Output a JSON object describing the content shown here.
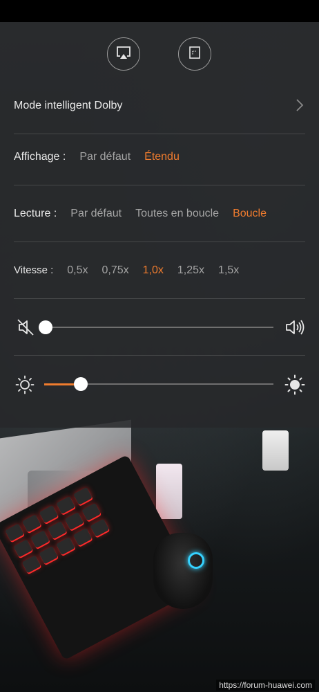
{
  "settings": {
    "dolby_label": "Mode intelligent Dolby",
    "display": {
      "label": "Affichage :",
      "options": [
        "Par défaut",
        "Étendu"
      ],
      "selected": "Étendu"
    },
    "playback": {
      "label": "Lecture :",
      "options": [
        "Par défaut",
        "Toutes en boucle",
        "Boucle"
      ],
      "selected": "Boucle"
    },
    "speed": {
      "label": "Vitesse :",
      "options": [
        "0,5x",
        "0,75x",
        "1,0x",
        "1,25x",
        "1,5x"
      ],
      "selected": "1,0x"
    },
    "volume": {
      "level": 0.0
    },
    "brightness": {
      "level": 0.16
    }
  },
  "icons": {
    "airplay": "screen-cast-icon",
    "pip": "picture-in-picture-icon",
    "mute": "volume-mute-icon",
    "volume_up": "volume-up-icon",
    "brightness_low": "brightness-low-icon",
    "brightness_high": "brightness-high-icon"
  },
  "colors": {
    "accent": "#f07c2e",
    "text": "#e9e9e9",
    "muted": "#a5a5a5"
  },
  "watermark": "https://forum-huawei.com"
}
